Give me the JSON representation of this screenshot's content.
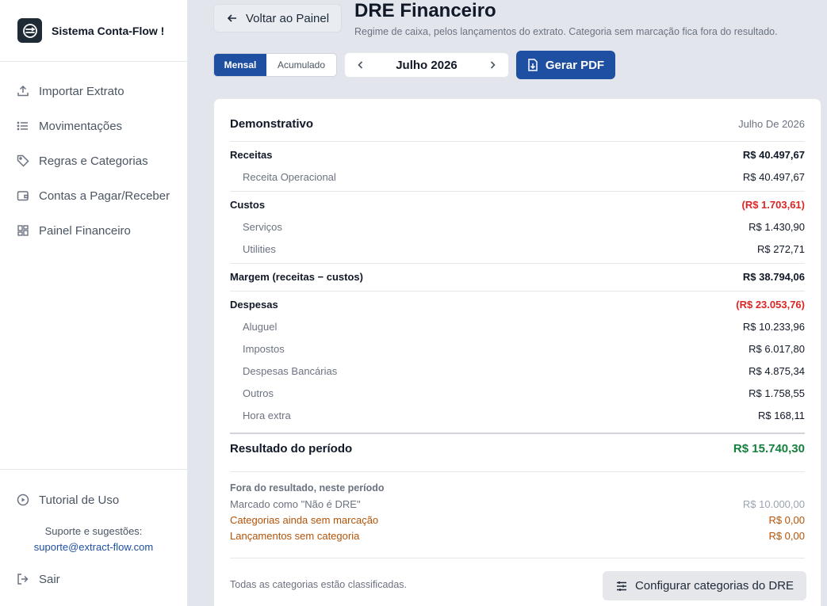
{
  "app": {
    "name": "Sistema Conta-Flow !"
  },
  "sidebar": {
    "items": [
      {
        "label": "Importar Extrato",
        "icon": "upload-icon"
      },
      {
        "label": "Movimentações",
        "icon": "list-icon"
      },
      {
        "label": "Regras e Categorias",
        "icon": "tag-icon"
      },
      {
        "label": "Contas a Pagar/Receber",
        "icon": "wallet-icon"
      },
      {
        "label": "Painel Financeiro",
        "icon": "dashboard-icon"
      }
    ],
    "tutorial_label": "Tutorial de Uso",
    "support_label": "Suporte e sugestões:",
    "support_email": "suporte@extract-flow.com",
    "logout_label": "Sair"
  },
  "header": {
    "back_label": "Voltar ao Painel",
    "title": "DRE Financeiro",
    "subtitle": "Regime de caixa, pelos lançamentos do extrato. Categoria sem marcação fica fora do resultado."
  },
  "toolbar": {
    "mode_monthly": "Mensal",
    "mode_cumulative": "Acumulado",
    "period_label": "Julho 2026",
    "pdf_label": "Gerar PDF"
  },
  "statement": {
    "title": "Demonstrativo",
    "period": "Julho De 2026",
    "revenue": {
      "label": "Receitas",
      "value": "R$ 40.497,67"
    },
    "revenue_items": [
      {
        "label": "Receita Operacional",
        "value": "R$ 40.497,67"
      }
    ],
    "costs": {
      "label": "Custos",
      "value": "(R$ 1.703,61)"
    },
    "cost_items": [
      {
        "label": "Serviços",
        "value": "R$ 1.430,90"
      },
      {
        "label": "Utilities",
        "value": "R$ 272,71"
      }
    ],
    "margin": {
      "label": "Margem (receitas − custos)",
      "value": "R$ 38.794,06"
    },
    "expenses": {
      "label": "Despesas",
      "value": "(R$ 23.053,76)"
    },
    "expense_items": [
      {
        "label": "Aluguel",
        "value": "R$ 10.233,96"
      },
      {
        "label": "Impostos",
        "value": "R$ 6.017,80"
      },
      {
        "label": "Despesas Bancárias",
        "value": "R$ 4.875,34"
      },
      {
        "label": "Outros",
        "value": "R$ 1.758,55"
      },
      {
        "label": "Hora extra",
        "value": "R$ 168,11"
      }
    ],
    "result": {
      "label": "Resultado do período",
      "value": "R$ 15.740,30"
    },
    "outside": {
      "title": "Fora do resultado, neste período",
      "not_dre": {
        "label": "Marcado como \"Não é DRE\"",
        "value": "R$ 10.000,00"
      },
      "unmarked": {
        "label": "Categorias ainda sem marcação",
        "value": "R$ 0,00"
      },
      "uncategorized": {
        "label": "Lançamentos sem categoria",
        "value": "R$ 0,00"
      }
    },
    "footer_note": "Todas as categorias estão classificadas.",
    "config_label": "Configurar categorias do DRE"
  },
  "colors": {
    "primary": "#1e4fa0",
    "negative": "#dc2626",
    "positive": "#15803d",
    "warning": "#b45309"
  }
}
